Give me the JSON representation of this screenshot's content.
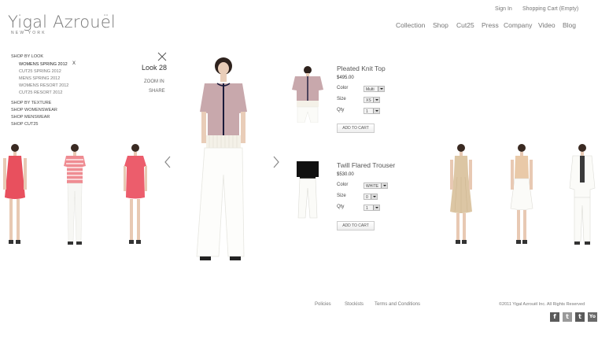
{
  "brand": {
    "name": "Yigal Azrouël",
    "sub": "NEW YORK"
  },
  "utility": {
    "sign_in": "Sign In",
    "cart": "Shopping Cart (Empty)"
  },
  "nav": [
    "Collection",
    "Shop",
    "Cut25",
    "Press",
    "Company",
    "Video",
    "Blog"
  ],
  "menu": {
    "shop_by_look": "SHOP BY LOOK",
    "looks": [
      {
        "label": "WOMENS SPRING 2012",
        "active": true,
        "remove": "X"
      },
      {
        "label": "CUT25 SPRING 2012"
      },
      {
        "label": "MENS SPRING 2012"
      },
      {
        "label": "WOMENS RESORT 2012"
      },
      {
        "label": "CUT25 RESORT 2012"
      }
    ],
    "other": [
      "SHOP BY TEXTURE",
      "SHOP WOMENSWEAR",
      "SHOP MENSWEAR",
      "SHOP CUT25"
    ]
  },
  "look": {
    "title": "Look 28",
    "zoom": "ZOOM IN",
    "share": "SHARE"
  },
  "products": [
    {
      "name": "Pleated Knit Top",
      "price": "$495.00",
      "color_label": "Color",
      "color_value": "Multi",
      "size_label": "Size",
      "size_value": "XS",
      "qty_label": "Qty",
      "qty_value": "1",
      "cart_label": "ADD TO CART"
    },
    {
      "name": "Twill Flared Trouser",
      "price": "$530.00",
      "color_label": "Color",
      "color_value": "WHITE",
      "size_label": "Size",
      "size_value": "0",
      "qty_label": "Qty",
      "qty_value": "1",
      "cart_label": "ADD TO CART"
    }
  ],
  "footer": {
    "links": [
      "Policies",
      "Stockists",
      "Terms and Conditions"
    ],
    "copyright": "©2011 Yigal Azrouël Inc. All Rights Reserved",
    "social": [
      {
        "icon": "facebook-icon",
        "glyph": "f",
        "color": "#5a5a5a"
      },
      {
        "icon": "twitter-icon",
        "glyph": "t",
        "color": "#9a9a9a"
      },
      {
        "icon": "tumblr-icon",
        "glyph": "t",
        "color": "#5a5a5a"
      },
      {
        "icon": "youtube-icon",
        "glyph": "Yo",
        "color": "#6a6a6a"
      }
    ]
  }
}
